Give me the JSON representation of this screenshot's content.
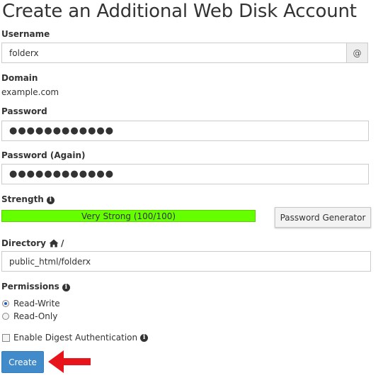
{
  "page": {
    "title": "Create an Additional Web Disk Account"
  },
  "username": {
    "label": "Username",
    "value": "folderx",
    "addon": "@"
  },
  "domain": {
    "label": "Domain",
    "value": "example.com"
  },
  "password": {
    "label": "Password",
    "value": "●●●●●●●●●●●●"
  },
  "password_again": {
    "label": "Password (Again)",
    "value": "●●●●●●●●●●●●"
  },
  "strength": {
    "label": "Strength",
    "text": "Very Strong (100/100)",
    "percent": 100,
    "color": "#66ff00"
  },
  "password_generator": {
    "label": "Password Generator"
  },
  "directory": {
    "label": "Directory",
    "separator": "/",
    "value": "public_html/folderx"
  },
  "permissions": {
    "label": "Permissions",
    "options": [
      {
        "label": "Read-Write",
        "selected": true
      },
      {
        "label": "Read-Only",
        "selected": false
      }
    ]
  },
  "digest": {
    "label": "Enable Digest Authentication",
    "checked": false
  },
  "create": {
    "label": "Create",
    "color": "#428bca"
  },
  "annotation": {
    "arrow_color": "#e8141c"
  },
  "icons": {
    "info": "info-circle-icon",
    "home": "home-icon",
    "arrow": "red-arrow-icon"
  }
}
